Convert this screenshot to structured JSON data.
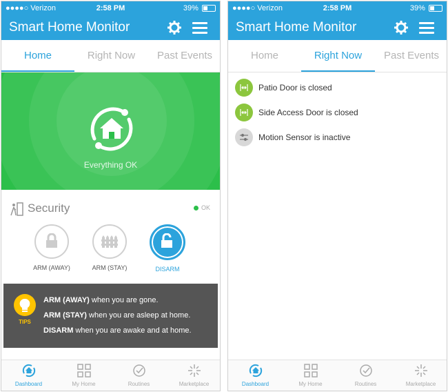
{
  "status_bar": {
    "carrier": "●●●●○ Verizon",
    "time": "2:58 PM",
    "battery": "39%"
  },
  "app_title": "Smart Home Monitor",
  "tabs": [
    "Home",
    "Right Now",
    "Past Events"
  ],
  "left": {
    "active_tab": "Home",
    "hero_status": "Everything OK",
    "security": {
      "title": "Security",
      "status": "OK"
    },
    "arm_buttons": [
      {
        "label": "ARM (AWAY)",
        "selected": false
      },
      {
        "label": "ARM (STAY)",
        "selected": false
      },
      {
        "label": "DISARM",
        "selected": true
      }
    ],
    "tips": {
      "label": "TIPS",
      "lines": [
        {
          "bold": "ARM (AWAY)",
          "text": " when you are gone."
        },
        {
          "bold": "ARM (STAY)",
          "text": " when you are asleep at home."
        },
        {
          "bold": "DISARM",
          "text": " when you are awake and at home."
        }
      ]
    }
  },
  "right": {
    "active_tab": "Right Now",
    "items": [
      {
        "text": "Patio Door is closed",
        "color": "green"
      },
      {
        "text": "Side Access Door is closed",
        "color": "green"
      },
      {
        "text": "Motion Sensor is inactive",
        "color": "grey"
      }
    ]
  },
  "bottom_nav": [
    {
      "label": "Dashboard",
      "icon": "dashboard-icon",
      "active": true
    },
    {
      "label": "My Home",
      "icon": "grid-icon",
      "active": false
    },
    {
      "label": "Routines",
      "icon": "check-circle-icon",
      "active": false
    },
    {
      "label": "Marketplace",
      "icon": "sparkle-icon",
      "active": false
    }
  ],
  "colors": {
    "primary": "#2ca3dc",
    "green": "#2cbf4a",
    "tips_bg": "#555555",
    "tips_accent": "#ffc400"
  }
}
